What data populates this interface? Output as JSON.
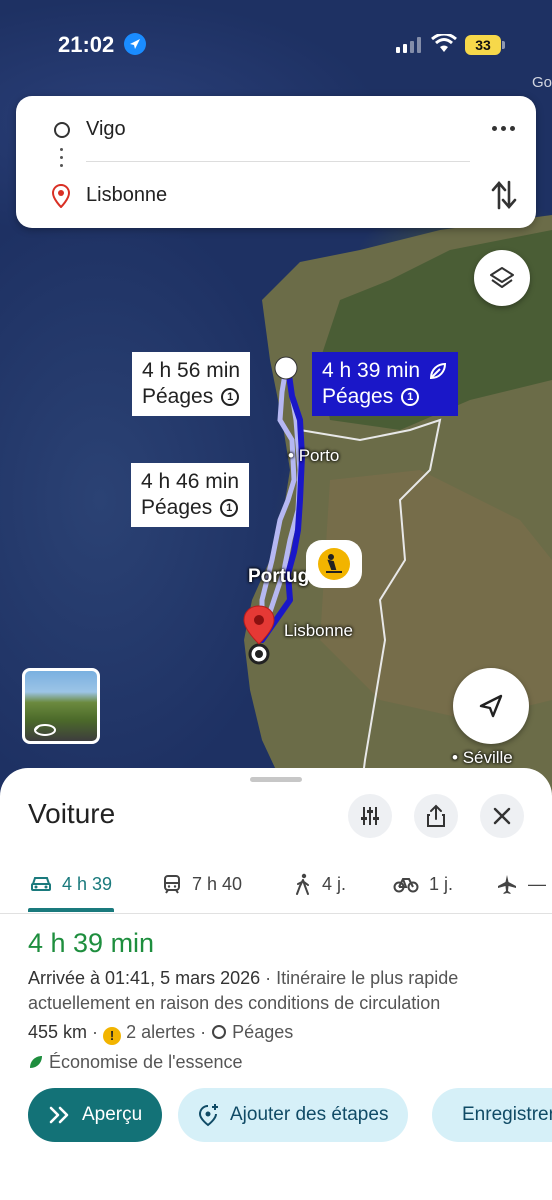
{
  "status_bar": {
    "time": "21:02",
    "battery": "33"
  },
  "map": {
    "attribution": "Go",
    "labels": {
      "porto": "Porto",
      "portugal": "Portug",
      "lisbonne": "Lisbonne",
      "seville": "Séville"
    },
    "route_labels": [
      {
        "duration": "4 h 56 min",
        "sub": "Péages",
        "active": false
      },
      {
        "duration": "4 h 39 min",
        "sub": "Péages",
        "active": true
      },
      {
        "duration": "4 h 46 min",
        "sub": "Péages",
        "active": false
      }
    ],
    "toll_glyph": "1",
    "colors": {
      "active_route": "#1a17c8",
      "alt_route": "#b6b8f2",
      "pin": "#e53935"
    }
  },
  "search": {
    "origin": "Vigo",
    "destination": "Lisbonne"
  },
  "sheet": {
    "title": "Voiture",
    "modes": [
      {
        "icon": "car-icon",
        "label": "4 h 39",
        "active": true
      },
      {
        "icon": "train-icon",
        "label": "7 h 40",
        "active": false
      },
      {
        "icon": "walk-icon",
        "label": "4 j.",
        "active": false
      },
      {
        "icon": "bike-icon",
        "label": "1 j.",
        "active": false
      },
      {
        "icon": "plane-icon",
        "label": "—",
        "active": false
      }
    ],
    "route": {
      "duration": "4 h 39 min",
      "arrival": "Arrivée à 01:41, 5 mars 2026",
      "reason": " · Itinéraire le plus rapide actuellement en raison des conditions de circulation",
      "distance": "455 km",
      "sep": "·",
      "alerts": "2 alertes",
      "alert_glyph": "!",
      "tolls": "Péages",
      "eco": "Économise de l'essence"
    },
    "actions": {
      "overview": "Aperçu",
      "add_stops": "Ajouter des étapes",
      "save": "Enregistrer"
    }
  }
}
